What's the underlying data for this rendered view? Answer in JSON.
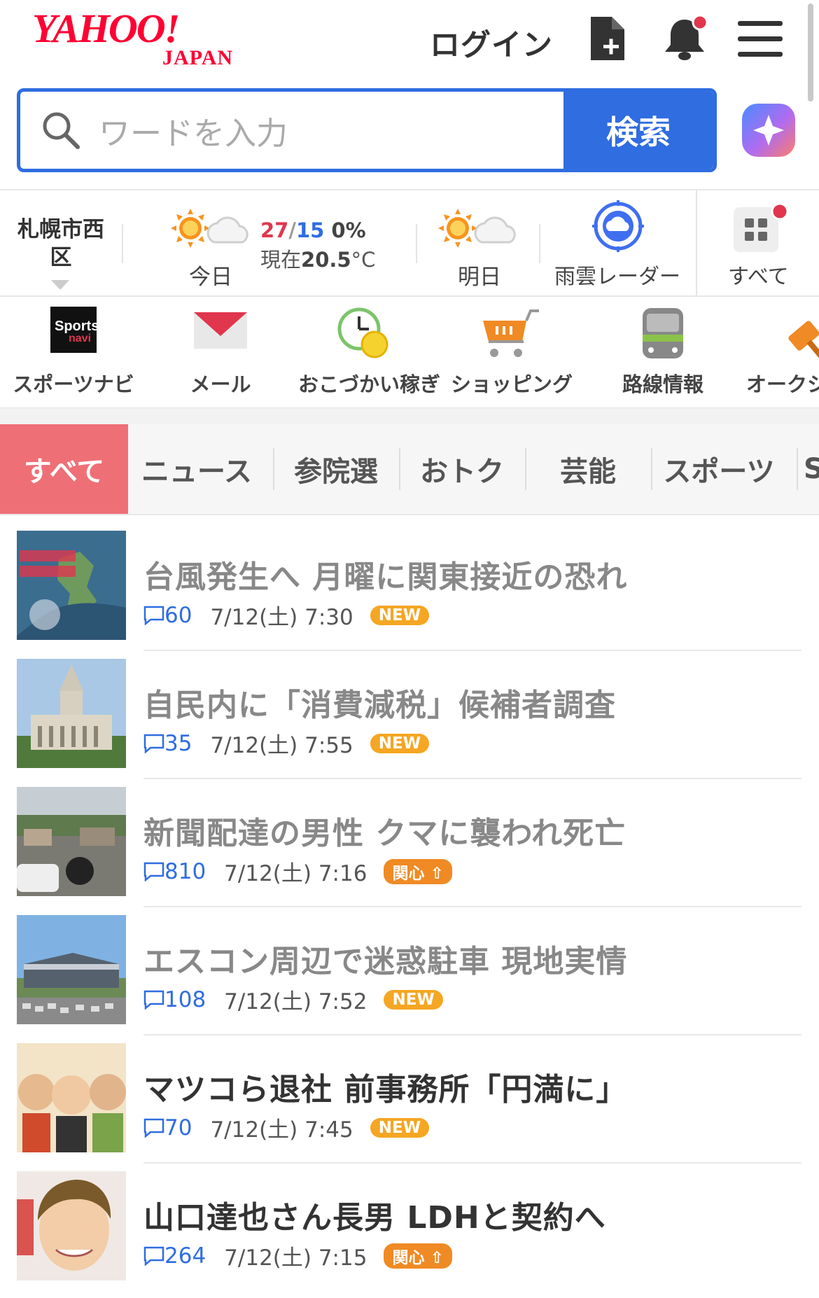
{
  "header": {
    "logo_main": "YAHOO!",
    "logo_sub": "JAPAN",
    "login_label": "ログイン"
  },
  "search": {
    "placeholder": "ワードを入力",
    "button_label": "検索"
  },
  "weather": {
    "location": "札幌市西区",
    "today_label": "今日",
    "high": "27",
    "slash": "/",
    "low": "15",
    "rain": "0%",
    "now_prefix": "現在",
    "now_temp": "20.5",
    "now_unit": "°C",
    "tomorrow_label": "明日",
    "radar_label": "雨雲レーダー",
    "all_label": "すべて"
  },
  "services": [
    {
      "label": "スポーツナビ",
      "icon": "sportsnavi-icon"
    },
    {
      "label": "メール",
      "icon": "mail-icon"
    },
    {
      "label": "おこづかい稼ぎ",
      "icon": "clock-coin-icon"
    },
    {
      "label": "ショッピング",
      "icon": "shopping-cart-icon"
    },
    {
      "label": "路線情報",
      "icon": "train-icon"
    },
    {
      "label": "オークシ",
      "icon": "auction-hammer-icon"
    }
  ],
  "tabs": [
    "すべて",
    "ニュース",
    "参院選",
    "おトク",
    "芸能",
    "スポーツ",
    "S"
  ],
  "news": [
    {
      "title": "台風発生へ 月曜に関東接近の恐れ",
      "comments": "60",
      "time": "7/12(土) 7:30",
      "badge": "NEW"
    },
    {
      "title": "自民内に「消費減税」候補者調査",
      "comments": "35",
      "time": "7/12(土) 7:55",
      "badge": "NEW"
    },
    {
      "title": "新聞配達の男性 クマに襲われ死亡",
      "comments": "810",
      "time": "7/12(土) 7:16",
      "badge": "関心"
    },
    {
      "title": "エスコン周辺で迷惑駐車 現地実情",
      "comments": "108",
      "time": "7/12(土) 7:52",
      "badge": "NEW"
    },
    {
      "title": "マツコら退社 前事務所「円満に」",
      "comments": "70",
      "time": "7/12(土) 7:45",
      "badge": "NEW"
    },
    {
      "title": "山口達也さん長男 LDHと契約へ",
      "comments": "264",
      "time": "7/12(土) 7:15",
      "badge": "関心"
    }
  ],
  "colors": {
    "brand_red": "#ff0033",
    "accent_blue": "#2f6de1",
    "active_tab": "#ef6f76",
    "badge_orange": "#f5a623"
  }
}
